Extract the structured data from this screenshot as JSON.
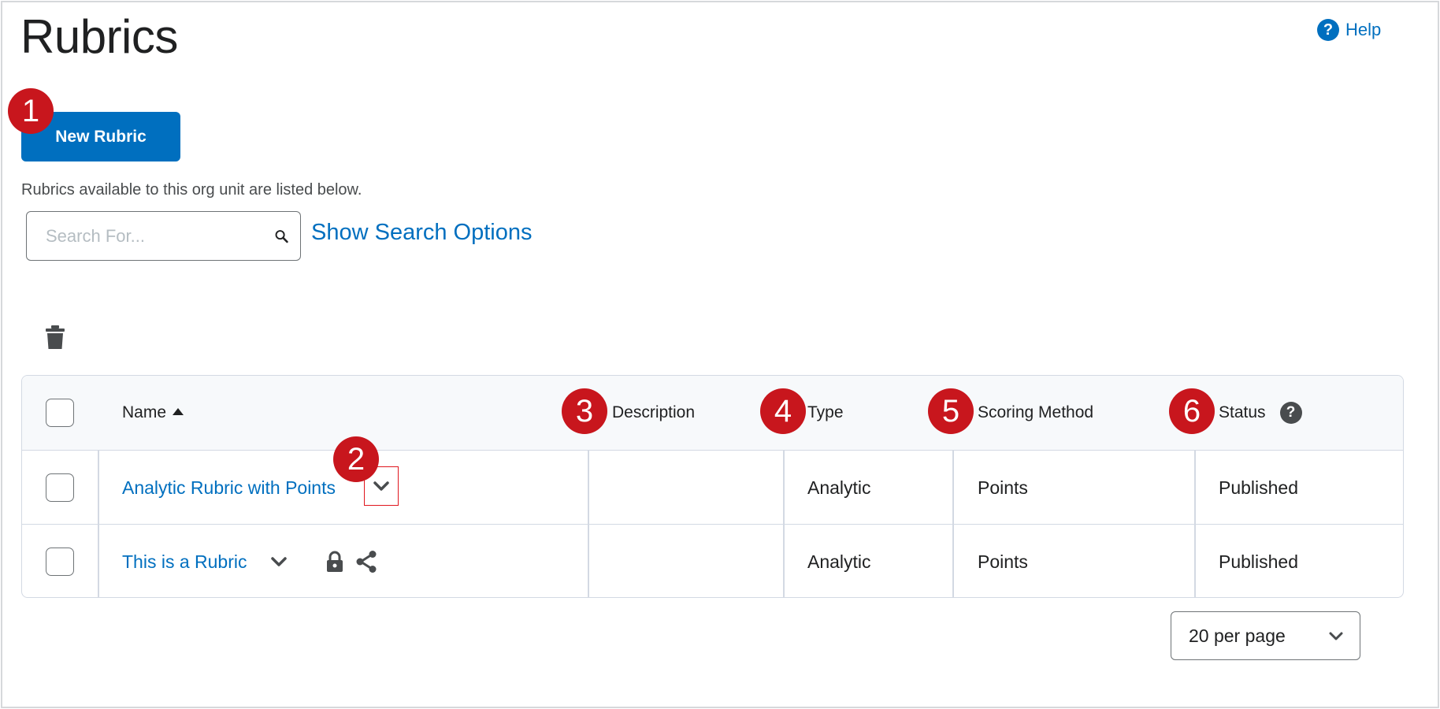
{
  "page": {
    "title": "Rubrics",
    "help_label": "Help"
  },
  "toolbar": {
    "new_rubric_label": "New Rubric"
  },
  "intro_text": "Rubrics available to this org unit are listed below.",
  "search": {
    "placeholder": "Search For...",
    "value": "",
    "options_label": "Show Search Options"
  },
  "table": {
    "columns": {
      "name": "Name",
      "description": "Description",
      "type": "Type",
      "scoring": "Scoring Method",
      "status": "Status"
    },
    "rows": [
      {
        "name": "Analytic Rubric with Points",
        "description": "",
        "type": "Analytic",
        "scoring": "Points",
        "status": "Published"
      },
      {
        "name": "This is a Rubric",
        "description": "",
        "type": "Analytic",
        "scoring": "Points",
        "status": "Published"
      }
    ]
  },
  "pagination": {
    "per_page_label": "20 per page"
  },
  "callouts": [
    "1",
    "2",
    "3",
    "4",
    "5",
    "6"
  ],
  "colors": {
    "primary": "#006fbf",
    "callout": "#c8161d",
    "highlight_border": "#e0161e"
  },
  "icons": [
    "help-icon",
    "search-icon",
    "trash-icon",
    "sort-asc-icon",
    "chevron-down-icon",
    "lock-icon",
    "share-icon"
  ]
}
